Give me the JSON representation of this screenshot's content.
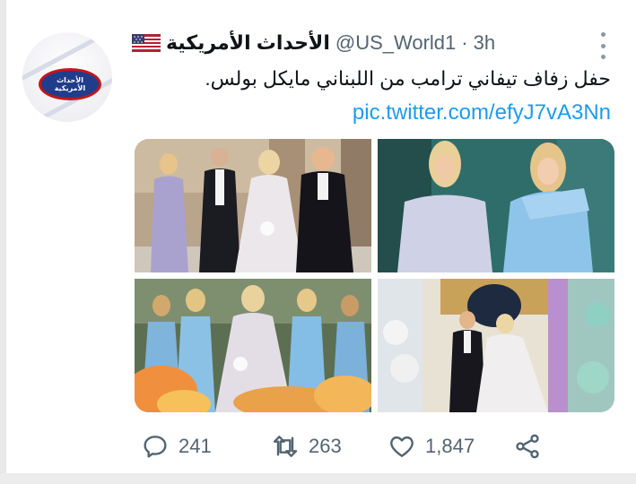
{
  "account": {
    "display_name": "الأحداث الأمريكية",
    "handle": "@US_World1",
    "separator": "·",
    "time": "3h",
    "avatar_badge_line1": "الأحداث",
    "avatar_badge_line2": "الأمريكية"
  },
  "tweet": {
    "text": "حفل زفاف تيفاني ترامب من اللبناني مايكل بولس.",
    "link": "pic.twitter.com/efyJ7vA3Nn"
  },
  "actions": {
    "replies": "241",
    "retweets": "263",
    "likes": "1,847"
  },
  "icons": {
    "flag": "us-flag-icon",
    "more": "more-vertical-icon",
    "reply": "reply-icon",
    "retweet": "retweet-icon",
    "like": "heart-icon",
    "share": "share-icon"
  },
  "colors": {
    "link": "#1d9bf0",
    "muted": "#536471",
    "text": "#0f1419"
  }
}
